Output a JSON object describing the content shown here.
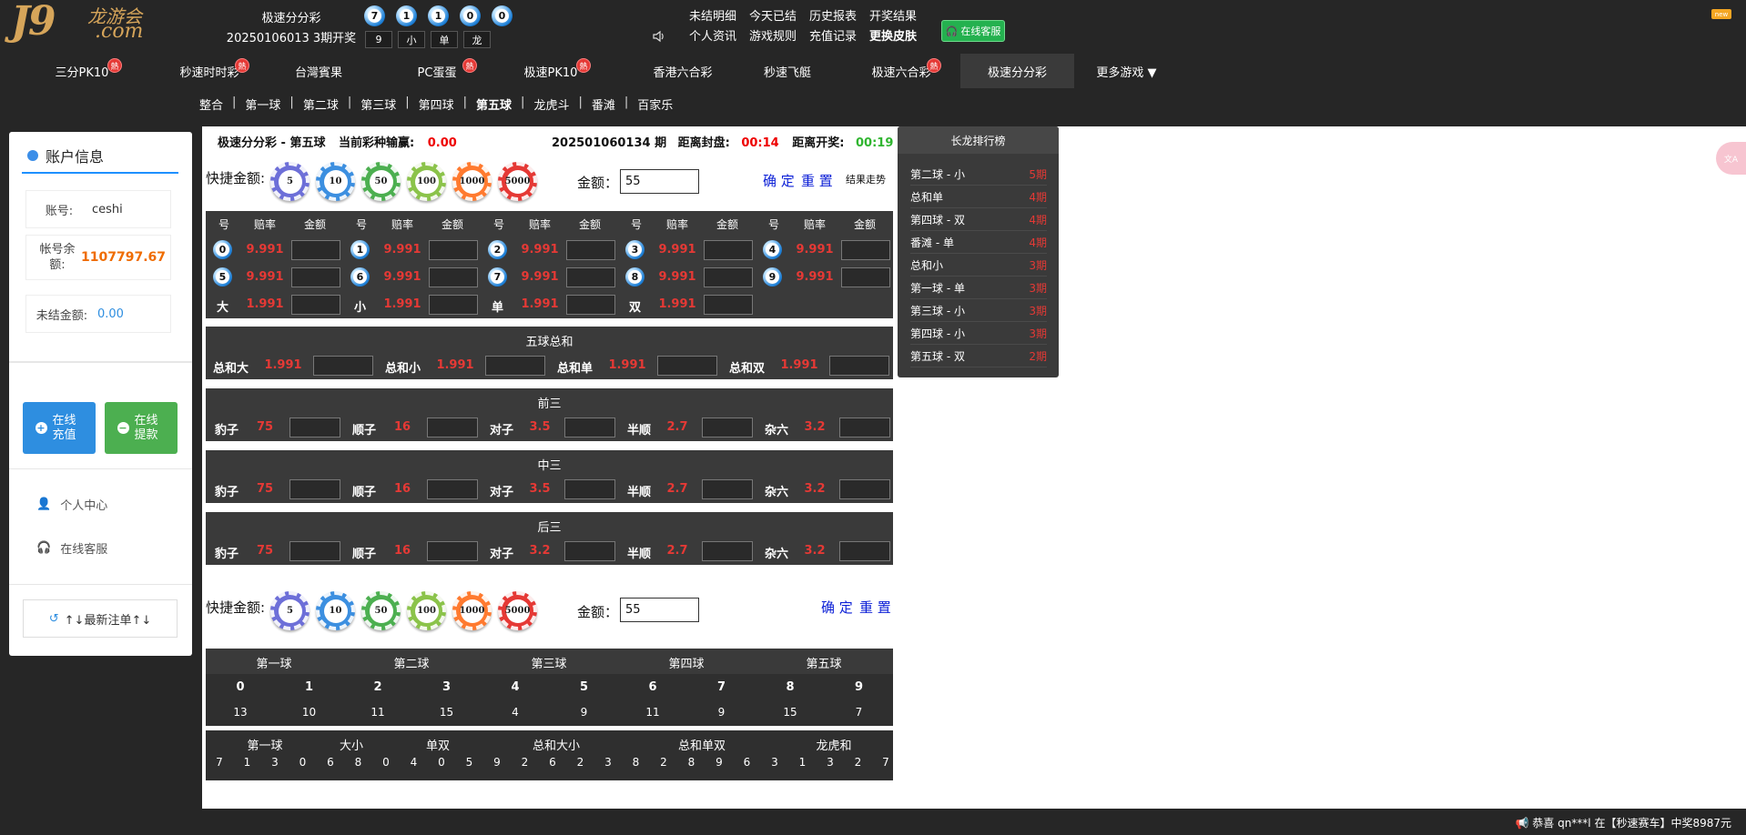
{
  "header": {
    "logo_main": "J9",
    "logo_sub": "龙游会",
    "logo_domain": ".com",
    "game_name": "极速分分彩",
    "issue_open": "20250106013 3期开奖",
    "draw_balls": [
      "7",
      "1",
      "1",
      "0",
      "0"
    ],
    "draw_stats": [
      "9",
      "小",
      "单",
      "龙"
    ],
    "links_row1": [
      "未结明细",
      "今天已结",
      "历史报表",
      "开奖结果"
    ],
    "links_row2": [
      "个人资讯",
      "游戏规则",
      "充值记录",
      "更换皮肤"
    ],
    "cs_label": "在线客服",
    "new_tag": "new"
  },
  "nav": {
    "items": [
      {
        "label": "三分PK10",
        "hot": true
      },
      {
        "label": "秒速时时彩",
        "hot": true
      },
      {
        "label": "台灣賓果",
        "hot": false
      },
      {
        "label": "PC蛋蛋",
        "hot": true
      },
      {
        "label": "极速PK10",
        "hot": true
      },
      {
        "label": "香港六合彩",
        "hot": false
      },
      {
        "label": "秒速飞艇",
        "hot": false
      },
      {
        "label": "极速六合彩",
        "hot": true
      },
      {
        "label": "极速分分彩",
        "hot": false
      },
      {
        "label": "更多游戏 ▼",
        "hot": false
      }
    ],
    "hot_label": "熱",
    "sub_items": [
      "整合",
      "第一球",
      "第二球",
      "第三球",
      "第四球",
      "第五球",
      "龙虎斗",
      "番滩",
      "百家乐"
    ]
  },
  "account": {
    "title": "账户信息",
    "account_label": "账号:",
    "account_value": "ceshi",
    "balance_label": "帐号余额:",
    "balance_value": "1107797.67",
    "unsettled_label": "未结金额:",
    "unsettled_value": "0.00",
    "deposit_label": "在线充值",
    "withdraw_label": "在线提款",
    "personal_center": "个人中心",
    "online_service": "在线客服",
    "recent_bets": "↑↓最新注单↑↓"
  },
  "bet_header": {
    "game": "极速分分彩",
    "dash": "-",
    "ball": "第五球",
    "pl_label": "当前彩种输赢:",
    "pl_value": "0.00",
    "issue": "202501060134 期",
    "close_label": "距离封盘:",
    "close_value": "00:14",
    "open_label": "距离开奖:",
    "open_value": "00:19"
  },
  "quick": {
    "label": "快捷金额:",
    "chips": [
      "5",
      "10",
      "50",
      "100",
      "1000",
      "5000"
    ],
    "chip_colors": [
      "#6d6fd8",
      "#3c8fe0",
      "#4caf50",
      "#8bc34a",
      "#ff7a2f",
      "#e53935"
    ],
    "amount_label": "金额：",
    "amount_value": "55",
    "confirm": "确 定",
    "reset": "重 置",
    "trend": "结果走势"
  },
  "numbers_table": {
    "headers": [
      "号",
      "赔率",
      "金额"
    ],
    "balls": [
      {
        "num": "0",
        "rate": "9.991"
      },
      {
        "num": "1",
        "rate": "9.991"
      },
      {
        "num": "2",
        "rate": "9.991"
      },
      {
        "num": "3",
        "rate": "9.991"
      },
      {
        "num": "4",
        "rate": "9.991"
      },
      {
        "num": "5",
        "rate": "9.991"
      },
      {
        "num": "6",
        "rate": "9.991"
      },
      {
        "num": "7",
        "rate": "9.991"
      },
      {
        "num": "8",
        "rate": "9.991"
      },
      {
        "num": "9",
        "rate": "9.991"
      }
    ],
    "bigsmall": [
      {
        "label": "大",
        "rate": "1.991"
      },
      {
        "label": "小",
        "rate": "1.991"
      },
      {
        "label": "单",
        "rate": "1.991"
      },
      {
        "label": "双",
        "rate": "1.991"
      }
    ]
  },
  "sum_section": {
    "title": "五球总和",
    "items": [
      {
        "label": "总和大",
        "rate": "1.991"
      },
      {
        "label": "总和小",
        "rate": "1.991"
      },
      {
        "label": "总和单",
        "rate": "1.991"
      },
      {
        "label": "总和双",
        "rate": "1.991"
      }
    ]
  },
  "sections": [
    {
      "title": "前三",
      "items": [
        {
          "label": "豹子",
          "rate": "75"
        },
        {
          "label": "顺子",
          "rate": "16"
        },
        {
          "label": "对子",
          "rate": "3.5"
        },
        {
          "label": "半顺",
          "rate": "2.7"
        },
        {
          "label": "杂六",
          "rate": "3.2"
        }
      ]
    },
    {
      "title": "中三",
      "items": [
        {
          "label": "豹子",
          "rate": "75"
        },
        {
          "label": "顺子",
          "rate": "16"
        },
        {
          "label": "对子",
          "rate": "3.5"
        },
        {
          "label": "半顺",
          "rate": "2.7"
        },
        {
          "label": "杂六",
          "rate": "3.2"
        }
      ]
    },
    {
      "title": "后三",
      "items": [
        {
          "label": "豹子",
          "rate": "75"
        },
        {
          "label": "顺子",
          "rate": "16"
        },
        {
          "label": "对子",
          "rate": "3.2"
        },
        {
          "label": "半顺",
          "rate": "2.7"
        },
        {
          "label": "杂六",
          "rate": "3.2"
        }
      ]
    }
  ],
  "long_dragon": {
    "title": "长龙排行榜",
    "rows": [
      {
        "label": "第二球 - 小",
        "n": "5期"
      },
      {
        "label": "总和单",
        "n": "4期"
      },
      {
        "label": "第四球 - 双",
        "n": "4期"
      },
      {
        "label": "番滩 - 单",
        "n": "4期"
      },
      {
        "label": "总和小",
        "n": "3期"
      },
      {
        "label": "第一球 - 单",
        "n": "3期"
      },
      {
        "label": "第三球 - 小",
        "n": "3期"
      },
      {
        "label": "第四球 - 小",
        "n": "3期"
      },
      {
        "label": "第五球 - 双",
        "n": "2期"
      }
    ]
  },
  "stats": {
    "balls": [
      "第一球",
      "第二球",
      "第三球",
      "第四球",
      "第五球"
    ],
    "digits": [
      "0",
      "1",
      "2",
      "3",
      "4",
      "5",
      "6",
      "7",
      "8",
      "9"
    ],
    "counts": [
      "13",
      "10",
      "11",
      "15",
      "4",
      "9",
      "11",
      "9",
      "15",
      "7"
    ]
  },
  "history": {
    "tabs": [
      "第一球",
      "大小",
      "单双",
      "总和大小",
      "总和单双",
      "龙虎和"
    ],
    "values": [
      "7",
      "1",
      "3",
      "0",
      "6",
      "8",
      "0",
      "4",
      "0",
      "5",
      "9",
      "2",
      "6",
      "2",
      "3",
      "8",
      "2",
      "8",
      "9",
      "6",
      "3",
      "1",
      "3",
      "2",
      "7"
    ]
  },
  "ticker": "恭喜 qn***l 在【秒速赛车】中奖8987元"
}
